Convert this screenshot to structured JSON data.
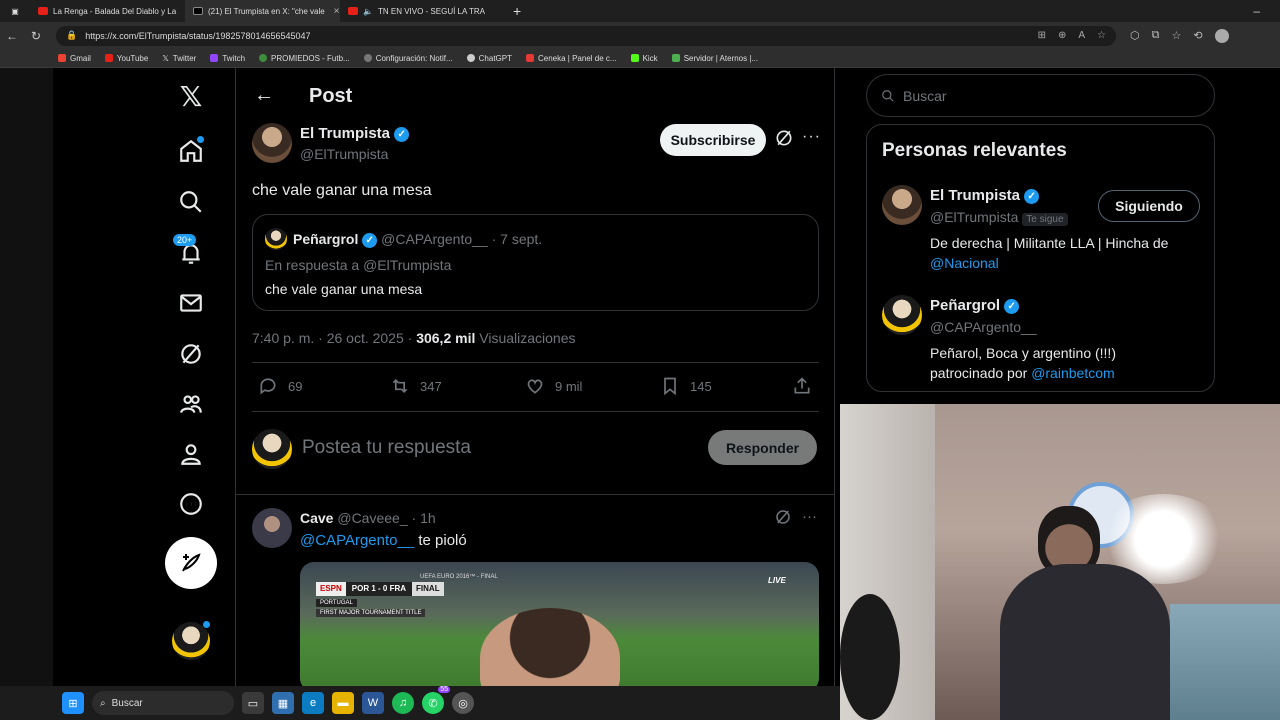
{
  "browser": {
    "tabs": [
      {
        "title": "La Renga - Balada Del Diablo y La",
        "active": false
      },
      {
        "title": "(21) El Trumpista en X: \"che vale",
        "active": true
      },
      {
        "title": "TN EN VIVO - SEGUÍ LA TRA",
        "active": false
      }
    ],
    "url": "https://x.com/ElTrumpista/status/1982578014656545047",
    "bookmarks": [
      "Gmail",
      "YouTube",
      "Twitter",
      "Twitch",
      "PROMIEDOS - Futb...",
      "Configuración: Notif...",
      "ChatGPT",
      "Ceneka | Panel de c...",
      "Kick",
      "Servidor | Aternos |..."
    ]
  },
  "nav": {
    "notifications_badge": "20+"
  },
  "header": {
    "title": "Post"
  },
  "post": {
    "author_name": "El Trumpista",
    "author_handle": "@ElTrumpista",
    "subscribe_label": "Subscribirse",
    "text": "che vale ganar una mesa",
    "quote": {
      "author_name": "Peñargrol",
      "author_handle": "@CAPArgento__",
      "date": "· 7 sept.",
      "reply_to_prefix": "En respuesta a",
      "reply_to_handle": "@ElTrumpista",
      "text": "che vale ganar una mesa"
    },
    "timestamp": "7:40 p. m. · 26 oct. 2025 ·",
    "views_count": "306,2 mil",
    "views_label": "Visualizaciones",
    "stats": {
      "replies": "69",
      "reposts": "347",
      "likes": "9 mil",
      "bookmarks": "145"
    }
  },
  "composer": {
    "placeholder": "Postea tu respuesta",
    "reply_label": "Responder"
  },
  "reply": {
    "author_name": "Cave",
    "author_handle": "@Caveee_",
    "time": "· 1h",
    "mention": "@CAPArgento__",
    "text": "te pioló",
    "video_overlay": {
      "network": "ESPN",
      "score": "POR 1 - 0 FRA",
      "event": "UEFA EURO 2016™ - FINAL",
      "status": "FINAL",
      "caption1": "PORTUGAL",
      "caption2": "FIRST MAJOR TOURNAMENT TITLE",
      "live": "LIVE"
    }
  },
  "sidebar": {
    "search_placeholder": "Buscar",
    "relevant_title": "Personas relevantes",
    "people": [
      {
        "name": "El Trumpista",
        "handle": "@ElTrumpista",
        "follows_you": "Te sigue",
        "button": "Siguiendo",
        "bio": "De derecha | Militante LLA | Hincha de",
        "bio_link": "@Nacional"
      },
      {
        "name": "Peñargrol",
        "handle": "@CAPArgento__",
        "bio": "Peñarol, Boca y argentino (!!!)",
        "bio2": "patrocinado por",
        "bio_link": "@rainbetcom"
      }
    ]
  },
  "taskbar": {
    "search_label": "Buscar",
    "whatsapp_badge": "55"
  }
}
